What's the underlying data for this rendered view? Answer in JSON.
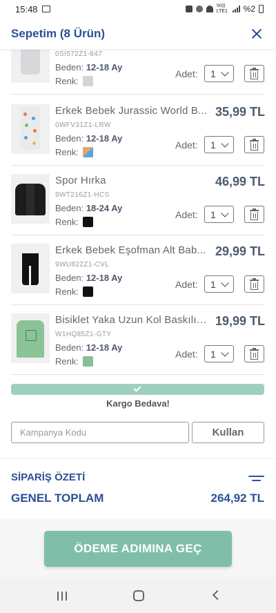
{
  "status_bar": {
    "time": "15:48",
    "network": "Vo)) LTE1",
    "battery": "%2"
  },
  "header": {
    "title": "Sepetim (8 Ürün)"
  },
  "labels": {
    "size": "Beden:",
    "color": "Renk:",
    "qty": "Adet:"
  },
  "items": [
    {
      "name": "",
      "price": "",
      "code": "0SI572Z1-847",
      "size": "12-18 Ay",
      "qty": "1",
      "swatch": "#d4d4d4"
    },
    {
      "name": "Erkek Bebek Jurassic World B...",
      "price": "35,99 TL",
      "code": "0WFV31Z1-LRW",
      "size": "12-18 Ay",
      "qty": "1",
      "swatch": "#e0a37a"
    },
    {
      "name": "Spor Hırka",
      "price": "46,99 TL",
      "code": "9WT216Z1-HCS",
      "size": "18-24 Ay",
      "qty": "1",
      "swatch": "#111111"
    },
    {
      "name": "Erkek Bebek Eşofman Alt Bab...",
      "price": "29,99 TL",
      "code": "9WU822Z1-CVL",
      "size": "12-18 Ay",
      "qty": "1",
      "swatch": "#111111"
    },
    {
      "name": "Bisiklet Yaka Uzun Kol Baskılı E...",
      "price": "19,99 TL",
      "code": "W1HQ85Z1-GTY",
      "size": "12-18 Ay",
      "qty": "1",
      "swatch": "#86c096"
    }
  ],
  "cargo": {
    "text": "Kargo Bedava!",
    "progress": 1.0
  },
  "coupon": {
    "placeholder": "Kampanya Kodu",
    "button": "Kullan"
  },
  "summary": {
    "title": "SİPARİŞ ÖZETİ",
    "total_label": "GENEL TOPLAM",
    "total_value": "264,92 TL"
  },
  "checkout": {
    "button": "ÖDEME ADIMINA GEÇ"
  }
}
